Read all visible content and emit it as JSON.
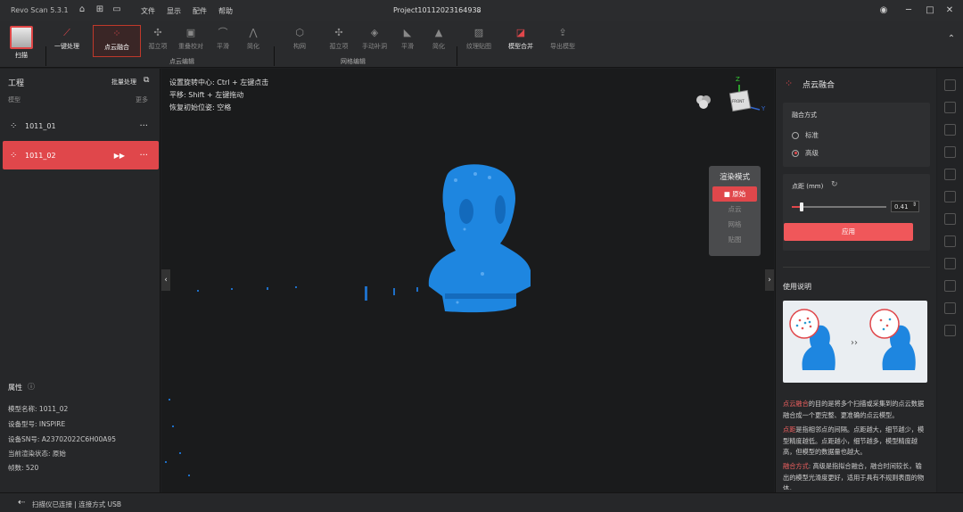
{
  "title_bar": {
    "app_version": "Revo Scan 5.3.1",
    "menus": [
      "文件",
      "显示",
      "配件",
      "帮助"
    ],
    "project_name": "Project10112023164938",
    "icons": [
      "home-icon",
      "add-icon",
      "folder-icon",
      "settings-icon",
      "minimize-icon",
      "maximize-icon",
      "close-icon"
    ]
  },
  "toolbar": {
    "scan_label": "扫描",
    "one_click_label": "一键处理",
    "tools": [
      "点云融合",
      "孤立项",
      "重叠校对",
      "平滑",
      "简化",
      "构网",
      "孤立项",
      "手动补洞",
      "平滑",
      "简化",
      "纹理贴图",
      "模型合并",
      "导出模型"
    ],
    "group_labels": [
      "点云编辑",
      "网格编辑"
    ]
  },
  "left_panel": {
    "title": "工程",
    "batch_label": "批量处理",
    "model_label": "模型",
    "more_label": "更多",
    "models": [
      "1011_01",
      "1011_02"
    ],
    "properties_title": "属性",
    "properties": [
      {
        "label": "模型名称:",
        "value": "1011_02"
      },
      {
        "label": "设备型号:",
        "value": "INSPIRE"
      },
      {
        "label": "设备SN号:",
        "value": "A23702022C6H00A95"
      },
      {
        "label": "当前渲染状态:",
        "value": "原始"
      },
      {
        "label": "帧数:",
        "value": "520"
      }
    ]
  },
  "viewport": {
    "hints": [
      "设置旋转中心: Ctrl + 左键点击",
      "平移: Shift + 左键拖动",
      "恢复初始位姿: 空格"
    ],
    "render_mode": {
      "title": "渲染模式",
      "options": [
        "原始",
        "点云",
        "网格",
        "贴图"
      ],
      "selected": "原始"
    },
    "axis_labels": [
      "Z",
      "Y"
    ],
    "cube_label": "FRONT"
  },
  "right_panel": {
    "title": "点云融合",
    "fusion_mode_label": "融合方式",
    "modes": [
      "标准",
      "高级"
    ],
    "selected_mode": "高级",
    "point_distance_label": "点距 (mm)",
    "point_distance_value": "0.41",
    "slider_fraction": 0.1,
    "apply_label": "应用",
    "usage_title": "使用说明",
    "usage_paragraphs": [
      {
        "highlight": "点云融合",
        "text": "的目的是将多个扫描或采集到的点云数据融合成一个更完整、更准确的点云模型。"
      },
      {
        "highlight": "点距",
        "text": "是指相邻点的间隔。点距越大，细节越少，模型精度越低。点距越小，细节越多，模型精度越高，但模型的数据量也越大。"
      },
      {
        "highlight": "融合方式",
        "text": ": 高级是指拟合融合，融合时间较长，输出的模型光滑度更好，适用于具有不规则表面的物体。"
      }
    ]
  },
  "status_bar": {
    "text": "扫描仪已连接 | 连接方式 USB"
  }
}
